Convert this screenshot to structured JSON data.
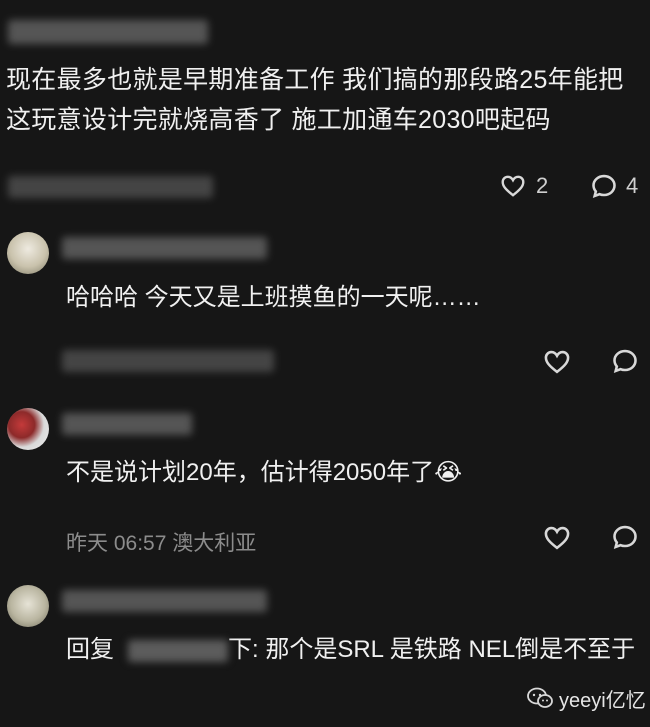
{
  "comments": [
    {
      "text": "现在最多也就是早期准备工作 我们搞的那段路25年能把这玩意设计完就烧高香了 施工加通车2030吧起码",
      "likes": "2",
      "replies": "4"
    },
    {
      "text": "哈哈哈 今天又是上班摸鱼的一天呢……"
    },
    {
      "text": "不是说计划20年，估计得2050年了",
      "emoji": "😭",
      "meta": "昨天 06:57 澳大利亚"
    },
    {
      "reply_prefix": "回复",
      "reply_target_tail": "下:",
      "text": "那个是SRL 是铁路 NEL倒是不至于"
    }
  ],
  "watermark": {
    "label": "yeeyi亿忆",
    "icon": "wechat-icon"
  },
  "icons": {
    "like": "heart-icon",
    "reply": "chat-bubble-icon"
  }
}
